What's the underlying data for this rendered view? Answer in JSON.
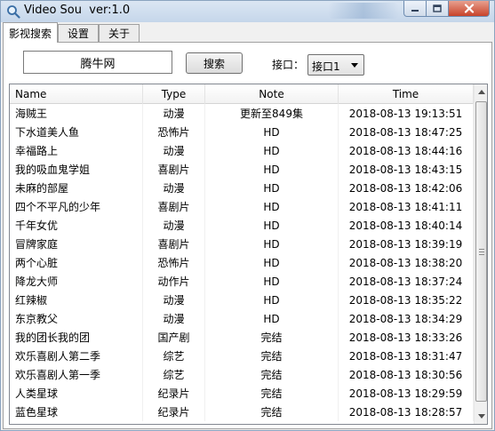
{
  "window": {
    "title": "Video Sou  ver:1.0"
  },
  "tabs": [
    {
      "label": "影视搜索"
    },
    {
      "label": "设置"
    },
    {
      "label": "关于"
    }
  ],
  "search": {
    "input_value": "腾牛网",
    "button_label": "搜索",
    "interface_label": "接口：",
    "interface_selected": "接口1"
  },
  "table": {
    "columns": [
      "Name",
      "Type",
      "Note",
      "Time"
    ],
    "rows": [
      {
        "name": "海贼王",
        "type": "动漫",
        "note": "更新至849集",
        "time": "2018-08-13 19:13:51"
      },
      {
        "name": "下水道美人鱼",
        "type": "恐怖片",
        "note": "HD",
        "time": "2018-08-13 18:47:25"
      },
      {
        "name": "幸福路上",
        "type": "动漫",
        "note": "HD",
        "time": "2018-08-13 18:44:16"
      },
      {
        "name": "我的吸血鬼学姐",
        "type": "喜剧片",
        "note": "HD",
        "time": "2018-08-13 18:43:15"
      },
      {
        "name": "未麻的部屋",
        "type": "动漫",
        "note": "HD",
        "time": "2018-08-13 18:42:06"
      },
      {
        "name": "四个不平凡的少年",
        "type": "喜剧片",
        "note": "HD",
        "time": "2018-08-13 18:41:11"
      },
      {
        "name": "千年女优",
        "type": "动漫",
        "note": "HD",
        "time": "2018-08-13 18:40:14"
      },
      {
        "name": "冒牌家庭",
        "type": "喜剧片",
        "note": "HD",
        "time": "2018-08-13 18:39:19"
      },
      {
        "name": "两个心脏",
        "type": "恐怖片",
        "note": "HD",
        "time": "2018-08-13 18:38:20"
      },
      {
        "name": "降龙大师",
        "type": "动作片",
        "note": "HD",
        "time": "2018-08-13 18:37:24"
      },
      {
        "name": "红辣椒",
        "type": "动漫",
        "note": "HD",
        "time": "2018-08-13 18:35:22"
      },
      {
        "name": "东京教父",
        "type": "动漫",
        "note": "HD",
        "time": "2018-08-13 18:34:29"
      },
      {
        "name": "我的团长我的团",
        "type": "国产剧",
        "note": "完结",
        "time": "2018-08-13 18:33:26"
      },
      {
        "name": "欢乐喜剧人第二季",
        "type": "综艺",
        "note": "完结",
        "time": "2018-08-13 18:31:47"
      },
      {
        "name": "欢乐喜剧人第一季",
        "type": "综艺",
        "note": "完结",
        "time": "2018-08-13 18:30:56"
      },
      {
        "name": "人类星球",
        "type": "纪录片",
        "note": "完结",
        "time": "2018-08-13 18:29:59"
      },
      {
        "name": "蓝色星球",
        "type": "纪录片",
        "note": "完结",
        "time": "2018-08-13 18:28:57"
      }
    ]
  },
  "icons": {
    "app": "magnifier-icon",
    "minimize": "minimize-icon",
    "maximize": "maximize-icon",
    "close": "close-icon",
    "scroll_up": "chevron-up-icon",
    "scroll_down": "chevron-down-icon"
  },
  "colors": {
    "titlebar": "#c5d6ea",
    "close_button": "#c7432a",
    "window_border": "#8aa3bf"
  },
  "scrollbar": {
    "position": 0.0,
    "visible_fraction": 0.93
  }
}
